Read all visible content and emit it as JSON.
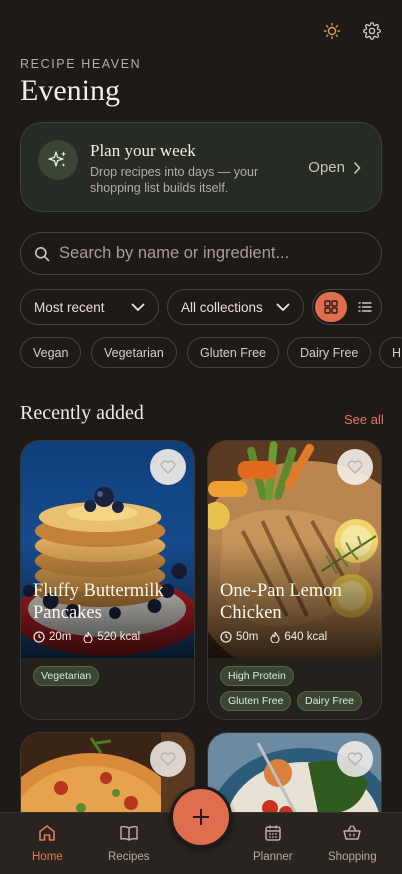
{
  "header": {
    "brand": "RECIPE HEAVEN",
    "greeting": "Evening",
    "theme_icon": "sun-icon",
    "settings_icon": "gear-icon"
  },
  "plan": {
    "title": "Plan your week",
    "subtitle": "Drop recipes into days — your shopping list builds itself.",
    "action": "Open",
    "icon": "sparkles-icon"
  },
  "search": {
    "placeholder": "Search by name or ingredient..."
  },
  "filters": {
    "sort": "Most recent",
    "collection": "All collections",
    "view_mode": "grid"
  },
  "chips": [
    "Vegan",
    "Vegetarian",
    "Gluten Free",
    "Dairy Free",
    "H"
  ],
  "section": {
    "title": "Recently added",
    "see_all": "See all"
  },
  "recipes": [
    {
      "title": "Fluffy Buttermilk Pancakes",
      "time": "20m",
      "kcal": "520 kcal",
      "tags": [
        "Vegetarian"
      ]
    },
    {
      "title": "One-Pan Lemon Chicken",
      "time": "50m",
      "kcal": "640 kcal",
      "tags": [
        "High Protein",
        "Gluten Free",
        "Dairy Free"
      ]
    }
  ],
  "nav": [
    {
      "label": "Home",
      "icon": "home-icon",
      "active": true
    },
    {
      "label": "Recipes",
      "icon": "book-icon",
      "active": false
    },
    {
      "label": "Planner",
      "icon": "calendar-icon",
      "active": false
    },
    {
      "label": "Shopping",
      "icon": "basket-icon",
      "active": false
    }
  ],
  "colors": {
    "accent": "#df6e4f",
    "background": "#1e1a17",
    "tag_green": "#3a4633"
  }
}
